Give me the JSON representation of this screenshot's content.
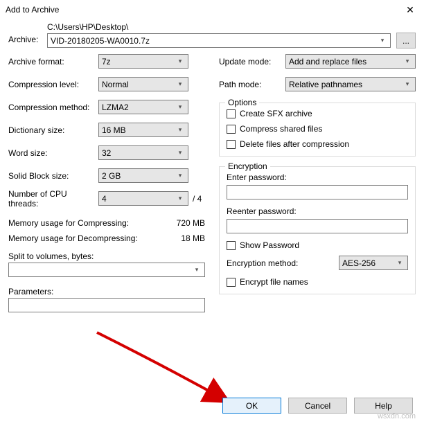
{
  "window": {
    "title": "Add to Archive"
  },
  "archive": {
    "label": "Archive:",
    "path": "C:\\Users\\HP\\Desktop\\",
    "filename": "VID-20180205-WA0010.7z",
    "browse": "..."
  },
  "left": {
    "format": {
      "label": "Archive format:",
      "value": "7z"
    },
    "level": {
      "label": "Compression level:",
      "value": "Normal"
    },
    "method": {
      "label": "Compression method:",
      "value": "LZMA2"
    },
    "dict": {
      "label": "Dictionary size:",
      "value": "16 MB"
    },
    "word": {
      "label": "Word size:",
      "value": "32"
    },
    "block": {
      "label": "Solid Block size:",
      "value": "2 GB"
    },
    "threads": {
      "label": "Number of CPU threads:",
      "value": "4",
      "total": "/ 4"
    },
    "memc": {
      "label": "Memory usage for Compressing:",
      "value": "720 MB"
    },
    "memd": {
      "label": "Memory usage for Decompressing:",
      "value": "18 MB"
    },
    "split": {
      "label": "Split to volumes, bytes:"
    },
    "params": {
      "label": "Parameters:"
    }
  },
  "right": {
    "update": {
      "label": "Update mode:",
      "value": "Add and replace files"
    },
    "pathmode": {
      "label": "Path mode:",
      "value": "Relative pathnames"
    },
    "options": {
      "legend": "Options",
      "sfx": "Create SFX archive",
      "shared": "Compress shared files",
      "delete": "Delete files after compression"
    },
    "encryption": {
      "legend": "Encryption",
      "enter": "Enter password:",
      "reenter": "Reenter password:",
      "show": "Show Password",
      "method_label": "Encryption method:",
      "method_value": "AES-256",
      "encnames": "Encrypt file names"
    }
  },
  "buttons": {
    "ok": "OK",
    "cancel": "Cancel",
    "help": "Help"
  },
  "watermark": "wsxdn.com"
}
